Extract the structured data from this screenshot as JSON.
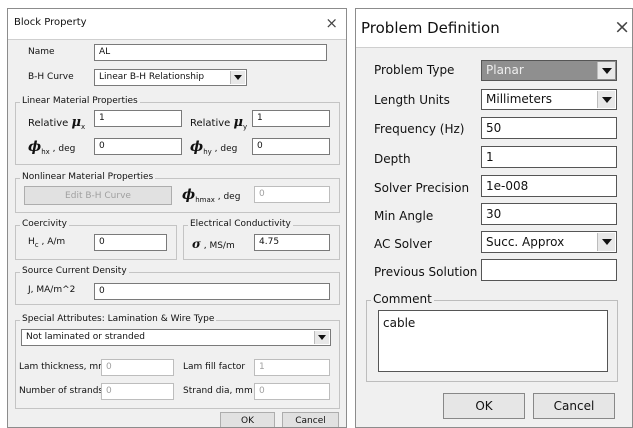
{
  "left": {
    "title": "Block Property",
    "close": "×",
    "name_label": "Name",
    "name_value": "AL",
    "bh_label": "B-H Curve",
    "bh_value": "Linear B-H Relationship",
    "linear_group": "Linear Material Properties",
    "rel_mu_x_label": "Relative",
    "mu_symbol": "μ",
    "mu_x_sub": "x",
    "mu_y_sub": "y",
    "rel_mu_x_value": "1",
    "rel_mu_y_label": "Relative",
    "rel_mu_y_value": "1",
    "phi_symbol": "ϕ",
    "phi_hx_sub": "hx",
    "phi_hy_sub": "hy",
    "deg_text": ", deg",
    "phi_hx_value": "0",
    "phi_hy_value": "0",
    "nonlinear_group": "Nonlinear Material Properties",
    "edit_bh_label": "Edit B-H Curve",
    "phi_hmax_sub": "hmax",
    "phi_hmax_deg": ", deg",
    "phi_hmax_value": "0",
    "coercivity_group": "Coercivity",
    "hc_main": "H",
    "hc_sub": "c",
    "hc_unit": ", A/m",
    "hc_value": "0",
    "elec_group": "Electrical Conductivity",
    "sigma_symbol": "σ",
    "sigma_unit": ", MS/m",
    "sigma_value": "4.75",
    "source_group": "Source Current Density",
    "j_label": "J, MA/m^2",
    "j_value": "0",
    "special_group": "Special Attributes:  Lamination & Wire Type",
    "lam_type_value": "Not laminated or stranded",
    "lam_thickness_label": "Lam thickness, mm",
    "lam_thickness_value": "0",
    "lam_fill_label": "Lam fill factor",
    "lam_fill_value": "1",
    "strands_label": "Number of strands",
    "strands_value": "0",
    "strand_dia_label": "Strand dia, mm",
    "strand_dia_value": "0",
    "ok": "OK",
    "cancel": "Cancel"
  },
  "right": {
    "title": "Problem Definition",
    "close": "×",
    "problem_type_label": "Problem Type",
    "problem_type_value": "Planar",
    "length_units_label": "Length Units",
    "length_units_value": "Millimeters",
    "frequency_label": "Frequency (Hz)",
    "frequency_value": "50",
    "depth_label": "Depth",
    "depth_value": "1",
    "solver_precision_label": "Solver Precision",
    "solver_precision_value": "1e-008",
    "min_angle_label": "Min Angle",
    "min_angle_value": "30",
    "ac_solver_label": "AC Solver",
    "ac_solver_value": "Succ. Approx",
    "previous_solution_label": "Previous Solution",
    "previous_solution_value": "",
    "comment_group": "Comment",
    "comment_value": "cable",
    "ok": "OK",
    "cancel": "Cancel"
  }
}
